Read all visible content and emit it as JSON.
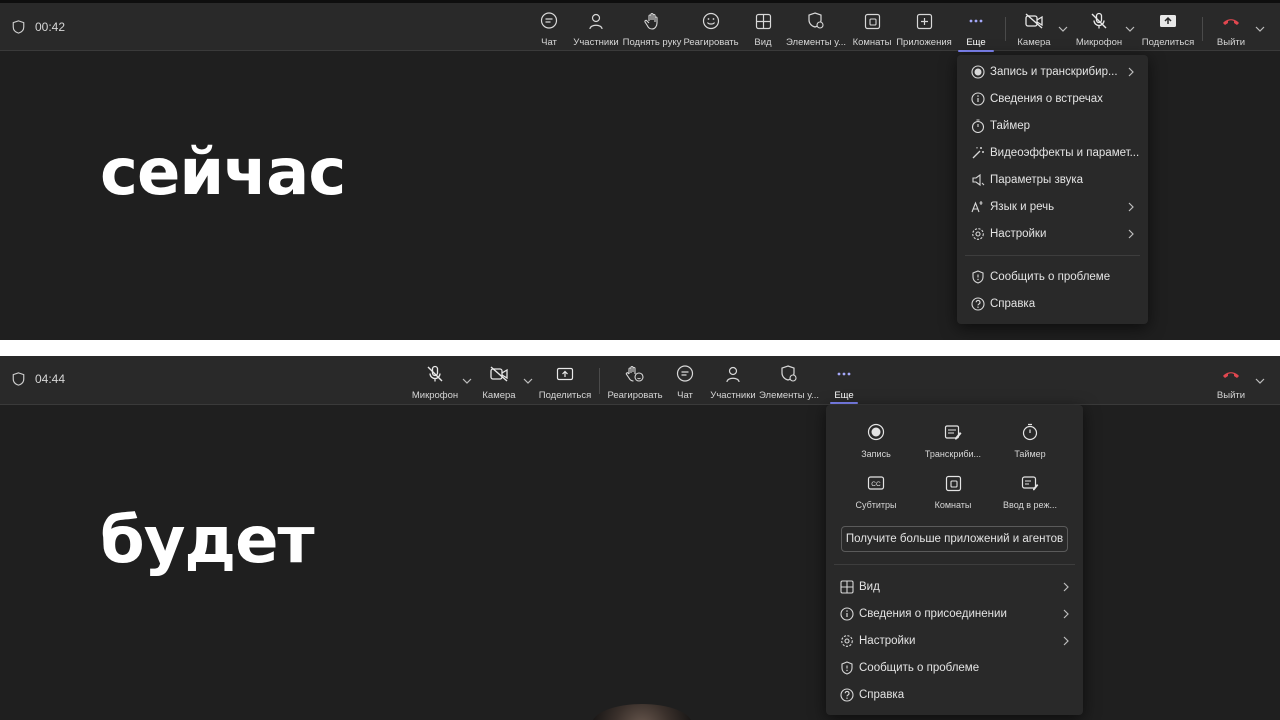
{
  "top": {
    "timer": "00:42",
    "big_word": "сейчас",
    "toolbar": [
      {
        "id": "chat",
        "label": "Чат"
      },
      {
        "id": "participants",
        "label": "Участники"
      },
      {
        "id": "raise_hand",
        "label": "Поднять руку"
      },
      {
        "id": "react",
        "label": "Реагировать"
      },
      {
        "id": "view",
        "label": "Вид"
      },
      {
        "id": "elements",
        "label": "Элементы у..."
      },
      {
        "id": "rooms",
        "label": "Комнаты"
      },
      {
        "id": "apps",
        "label": "Приложения"
      },
      {
        "id": "more",
        "label": "Еще"
      },
      {
        "id": "camera",
        "label": "Камера"
      },
      {
        "id": "mic",
        "label": "Микрофон"
      },
      {
        "id": "share",
        "label": "Поделиться"
      },
      {
        "id": "leave",
        "label": "Выйти"
      }
    ],
    "menu": [
      {
        "label": "Запись и транскрибир...",
        "icon": "record-icon",
        "submenu": true
      },
      {
        "label": "Сведения о встречах",
        "icon": "info-icon",
        "submenu": false
      },
      {
        "label": "Таймер",
        "icon": "timer-icon",
        "submenu": false
      },
      {
        "label": "Видеоэффекты и парамет...",
        "icon": "magic-wand-icon",
        "submenu": false
      },
      {
        "label": "Параметры звука",
        "icon": "speaker-icon",
        "submenu": false
      },
      {
        "label": "Язык и речь",
        "icon": "language-icon",
        "submenu": true
      },
      {
        "label": "Настройки",
        "icon": "gear-icon",
        "submenu": true
      },
      {
        "label": "Сообщить о проблеме",
        "icon": "shield-icon",
        "submenu": false
      },
      {
        "label": "Справка",
        "icon": "help-icon",
        "submenu": false
      }
    ]
  },
  "bottom": {
    "timer": "04:44",
    "big_word": "будет",
    "toolbar": [
      {
        "id": "mic",
        "label": "Микрофон"
      },
      {
        "id": "camera",
        "label": "Камера"
      },
      {
        "id": "share",
        "label": "Поделиться"
      },
      {
        "id": "react",
        "label": "Реагировать"
      },
      {
        "id": "chat",
        "label": "Чат"
      },
      {
        "id": "participants",
        "label": "Участники"
      },
      {
        "id": "elements",
        "label": "Элементы у..."
      },
      {
        "id": "more",
        "label": "Еще"
      },
      {
        "id": "leave",
        "label": "Выйти"
      }
    ],
    "grid": [
      {
        "label": "Запись",
        "icon": "record-icon"
      },
      {
        "label": "Транскриби...",
        "icon": "transcript-icon"
      },
      {
        "label": "Таймер",
        "icon": "timer-icon"
      },
      {
        "label": "Субтитры",
        "icon": "captions-icon"
      },
      {
        "label": "Комнаты",
        "icon": "rooms-icon"
      },
      {
        "label": "Ввод в реж...",
        "icon": "live-captions-icon"
      }
    ],
    "apps_button": "Получите больше приложений и агентов",
    "menu": [
      {
        "label": "Вид",
        "icon": "grid-icon",
        "submenu": true
      },
      {
        "label": "Сведения о присоединении",
        "icon": "info-icon",
        "submenu": true
      },
      {
        "label": "Настройки",
        "icon": "gear-icon",
        "submenu": true
      },
      {
        "label": "Сообщить о проблеме",
        "icon": "shield-icon",
        "submenu": false
      },
      {
        "label": "Справка",
        "icon": "help-icon",
        "submenu": false
      }
    ]
  },
  "colors": {
    "accent": "#7f85f5",
    "leave": "#e0474f",
    "background": "#1f1f1f",
    "toolbar": "#292929"
  }
}
